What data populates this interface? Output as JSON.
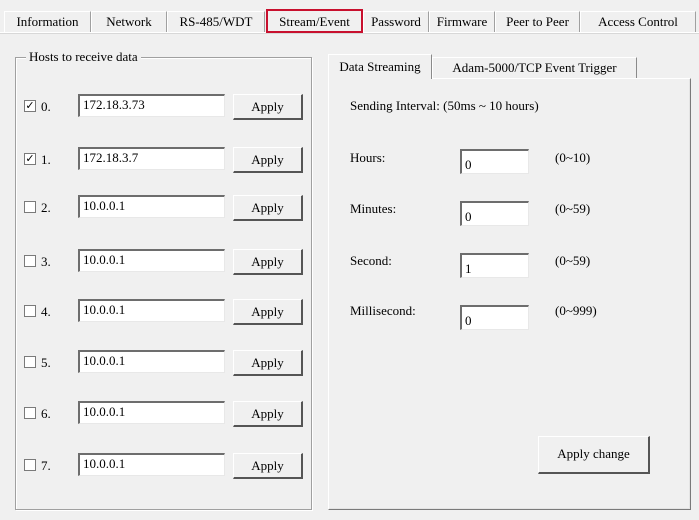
{
  "tabs": [
    {
      "label": "Information"
    },
    {
      "label": "Network"
    },
    {
      "label": "RS-485/WDT"
    },
    {
      "label": "Stream/Event",
      "active": true
    },
    {
      "label": "Password"
    },
    {
      "label": "Firmware"
    },
    {
      "label": "Peer to Peer"
    },
    {
      "label": "Access Control"
    }
  ],
  "hosts": {
    "title": "Hosts to receive data",
    "apply_label": "Apply",
    "rows": [
      {
        "index": "0.",
        "checked": true,
        "ip": "172.18.3.73"
      },
      {
        "index": "1.",
        "checked": true,
        "ip": "172.18.3.7"
      },
      {
        "index": "2.",
        "checked": false,
        "ip": "10.0.0.1"
      },
      {
        "index": "3.",
        "checked": false,
        "ip": "10.0.0.1"
      },
      {
        "index": "4.",
        "checked": false,
        "ip": "10.0.0.1"
      },
      {
        "index": "5.",
        "checked": false,
        "ip": "10.0.0.1"
      },
      {
        "index": "6.",
        "checked": false,
        "ip": "10.0.0.1"
      },
      {
        "index": "7.",
        "checked": false,
        "ip": "10.0.0.1"
      }
    ]
  },
  "subtabs": [
    {
      "label": "Data Streaming",
      "active": true
    },
    {
      "label": "Adam-5000/TCP Event Trigger"
    }
  ],
  "streaming": {
    "interval_label": "Sending Interval: (50ms ~ 10 hours)",
    "fields": [
      {
        "label": "Hours:",
        "value": "0",
        "range": "(0~10)"
      },
      {
        "label": "Minutes:",
        "value": "0",
        "range": "(0~59)"
      },
      {
        "label": "Second:",
        "value": "1",
        "range": "(0~59)"
      },
      {
        "label": "Millisecond:",
        "value": "0",
        "range": "(0~999)"
      }
    ],
    "apply_change_label": "Apply change"
  },
  "colors": {
    "active_tab_border": "#c8102e",
    "background": "#f0f0f0"
  }
}
